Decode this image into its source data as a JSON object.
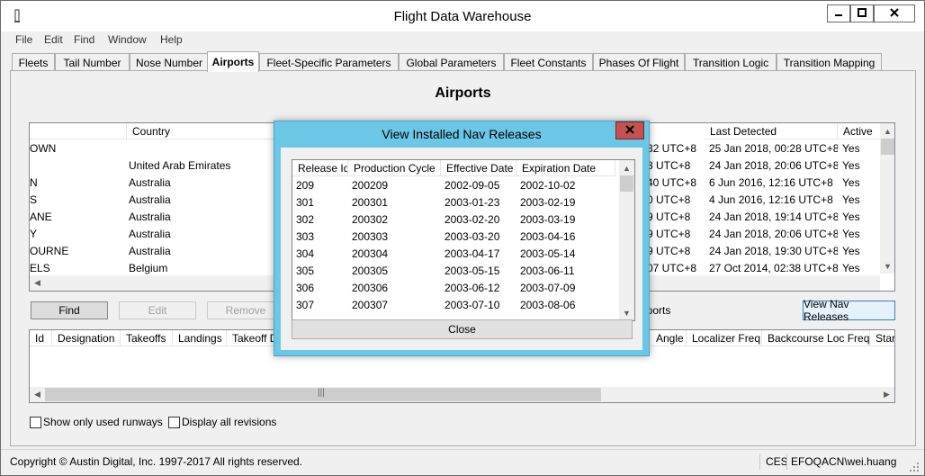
{
  "window": {
    "title": "Flight Data Warehouse"
  },
  "menu": [
    "File",
    "Edit",
    "Find",
    "Window",
    "Help"
  ],
  "tabs": [
    "Fleets",
    "Tail Number",
    "Nose Number",
    "Airports",
    "Fleet-Specific Parameters",
    "Global Parameters",
    "Fleet Constants",
    "Phases Of Flight",
    "Transition Logic",
    "Transition Mapping"
  ],
  "active_tab": "Airports",
  "page_title": "Airports",
  "airports_grid": {
    "headers": {
      "country": "Country",
      "last_detected": "Last Detected",
      "active": "Active"
    },
    "rows": [
      {
        "name": "OWN",
        "country": "",
        "mid": "32 UTC+8",
        "last_detected": "25 Jan 2018, 00:28 UTC+8",
        "active": "Yes"
      },
      {
        "name": "",
        "country": "United Arab Emirates",
        "mid": "3 UTC+8",
        "last_detected": "24 Jan 2018, 20:06 UTC+8",
        "active": "Yes"
      },
      {
        "name": "N",
        "country": "Australia",
        "mid": "40 UTC+8",
        "last_detected": "6 Jun 2016, 12:16 UTC+8",
        "active": "Yes"
      },
      {
        "name": "S",
        "country": "Australia",
        "mid": "0 UTC+8",
        "last_detected": "4 Jun 2016, 12:16 UTC+8",
        "active": "Yes"
      },
      {
        "name": "ANE",
        "country": "Australia",
        "mid": "9 UTC+8",
        "last_detected": "24 Jan 2018, 19:14 UTC+8",
        "active": "Yes"
      },
      {
        "name": "Y",
        "country": "Australia",
        "mid": "9 UTC+8",
        "last_detected": "24 Jan 2018, 20:06 UTC+8",
        "active": "Yes"
      },
      {
        "name": "OURNE",
        "country": "Australia",
        "mid": "9 UTC+8",
        "last_detected": "24 Jan 2018, 19:30 UTC+8",
        "active": "Yes"
      },
      {
        "name": "ELS",
        "country": "Belgium",
        "mid": "07 UTC+8",
        "last_detected": "27 Oct 2014, 02:38 UTC+8",
        "active": "Yes"
      }
    ]
  },
  "buttons": {
    "find": "Find",
    "edit": "Edit",
    "remove": "Remove",
    "airports_partial": "irports",
    "view_nav_releases": "View Nav Releases"
  },
  "runways_grid": {
    "headers": [
      "Id",
      "Designation",
      "Takeoffs",
      "Landings",
      "Takeoff D",
      "Angle",
      "Localizer Freq",
      "Backcourse Loc Freq",
      "Start"
    ]
  },
  "checkboxes": {
    "show_used_runways": "Show only used runways",
    "display_all_revisions": "Display all revisions"
  },
  "status": {
    "copyright": "Copyright © Austin Digital, Inc. 1997-2017 All rights reserved.",
    "tz": "CES",
    "user": "EFOQACN\\wei.huang"
  },
  "dialog": {
    "title": "View Installed Nav Releases",
    "headers": [
      "Release Id",
      "Production Cycle",
      "Effective Date",
      "Expiration Date"
    ],
    "rows": [
      [
        "209",
        "200209",
        "2002-09-05",
        "2002-10-02"
      ],
      [
        "301",
        "200301",
        "2003-01-23",
        "2003-02-19"
      ],
      [
        "302",
        "200302",
        "2003-02-20",
        "2003-03-19"
      ],
      [
        "303",
        "200303",
        "2003-03-20",
        "2003-04-16"
      ],
      [
        "304",
        "200304",
        "2003-04-17",
        "2003-05-14"
      ],
      [
        "305",
        "200305",
        "2003-05-15",
        "2003-06-11"
      ],
      [
        "306",
        "200306",
        "2003-06-12",
        "2003-07-09"
      ],
      [
        "307",
        "200307",
        "2003-07-10",
        "2003-08-06"
      ]
    ],
    "close_label": "Close"
  },
  "icons": {
    "app": "app-icon",
    "minimize": "minimize-icon",
    "maximize": "maximize-icon",
    "close": "close-icon"
  },
  "colors": {
    "dialog_frame": "#6cc6e6",
    "dialog_close": "#c75050",
    "focus_border": "#3c7fb1"
  }
}
